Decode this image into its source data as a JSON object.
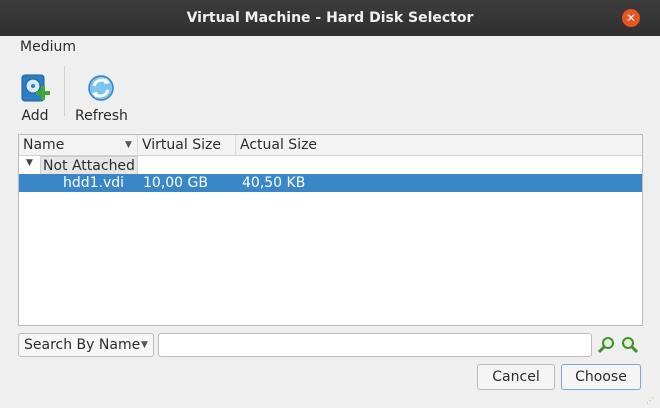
{
  "window": {
    "title": "Virtual Machine - Hard Disk Selector",
    "close_symbol": "✕"
  },
  "menu": {
    "items": [
      "Medium"
    ]
  },
  "toolbar": {
    "add_label": "Add",
    "refresh_label": "Refresh"
  },
  "table": {
    "columns": [
      "Name",
      "Virtual Size",
      "Actual Size"
    ],
    "group_label": "Not Attached",
    "rows": [
      {
        "name": "hdd1.vdi",
        "virtual_size": "10,00 GB",
        "actual_size": "40,50 KB",
        "selected": true
      }
    ]
  },
  "filter": {
    "mode": "Search By Name",
    "search_value": ""
  },
  "buttons": {
    "cancel_label": "Cancel",
    "choose_label": "Choose"
  },
  "colors": {
    "selection": "#3a87c7",
    "close": "#e95420",
    "titlebar": "#333333"
  }
}
